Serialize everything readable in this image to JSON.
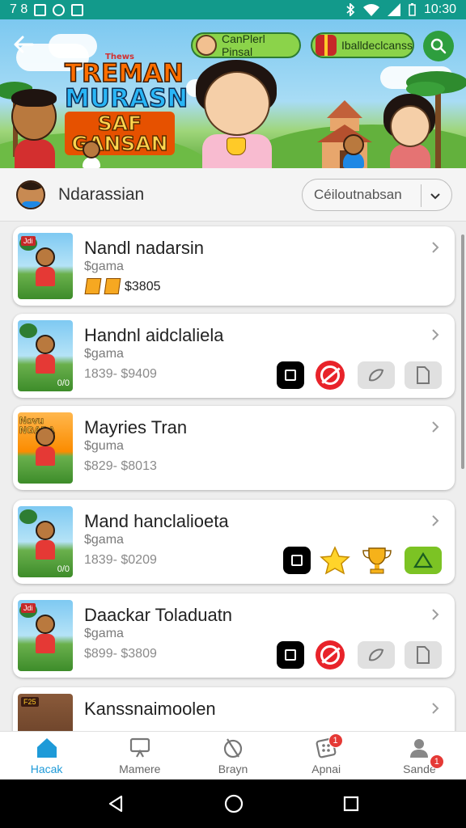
{
  "status_bar": {
    "time_left": "7 8",
    "time_right": "10:30"
  },
  "header": {
    "chip_1_label": "CanPlerl Pinsal",
    "chip_2_label": "Iballdeclcanss",
    "logo_small": "Thews",
    "logo_line_1": "TREMAN",
    "logo_line_2": "MURASN",
    "logo_line_3": "SAF GANSAN",
    "icons": [
      "back-arrow-icon",
      "search-icon"
    ]
  },
  "section": {
    "title": "Ndarassian",
    "sort_label": "Céiloutnabsan"
  },
  "games": [
    {
      "title": "Nandl nadarsin",
      "subtitle": "$gama",
      "price": "$3805",
      "badge": "Jdi",
      "actions": []
    },
    {
      "title": "Handnl aidclaliela",
      "subtitle": "$gama",
      "price": "1839- $9409",
      "badge": "0/0",
      "actions": [
        "square-icon",
        "block-icon",
        "wreath-icon",
        "document-icon"
      ]
    },
    {
      "title": "Mayries Tran",
      "subtitle": "$guma",
      "price": "$829- $8013",
      "badge": "Novu NGADA",
      "actions": []
    },
    {
      "title": "Mand hanclalioeta",
      "subtitle": "$gama",
      "price": "1839- $0209",
      "badge": "0/0",
      "actions": [
        "square-icon",
        "star-icon",
        "trophy-icon",
        "hat-icon"
      ]
    },
    {
      "title": "Daackar Toladuatn",
      "subtitle": "$gama",
      "price": "$899- $3809",
      "badge": "Jdi",
      "actions": [
        "square-icon",
        "block-icon",
        "wreath-icon",
        "document-icon"
      ]
    },
    {
      "title": "Kanssnaimoolen",
      "subtitle": "",
      "price": "",
      "badge": "F25",
      "actions": []
    }
  ],
  "bottom_nav": [
    {
      "label": "Hacak",
      "icon": "home-icon",
      "active": true,
      "badge": ""
    },
    {
      "label": "Mamere",
      "icon": "monitor-icon",
      "active": false,
      "badge": ""
    },
    {
      "label": "Brayn",
      "icon": "shape-icon",
      "active": false,
      "badge": ""
    },
    {
      "label": "Apnai",
      "icon": "grid-card-icon",
      "active": false,
      "badge": "1"
    },
    {
      "label": "Sande",
      "icon": "person-icon",
      "active": false,
      "badge": "1"
    }
  ],
  "colors": {
    "status_bar": "#129a8b",
    "accent_green": "#8bd34a",
    "active_nav": "#1e9ad8",
    "badge_red": "#e53935"
  }
}
